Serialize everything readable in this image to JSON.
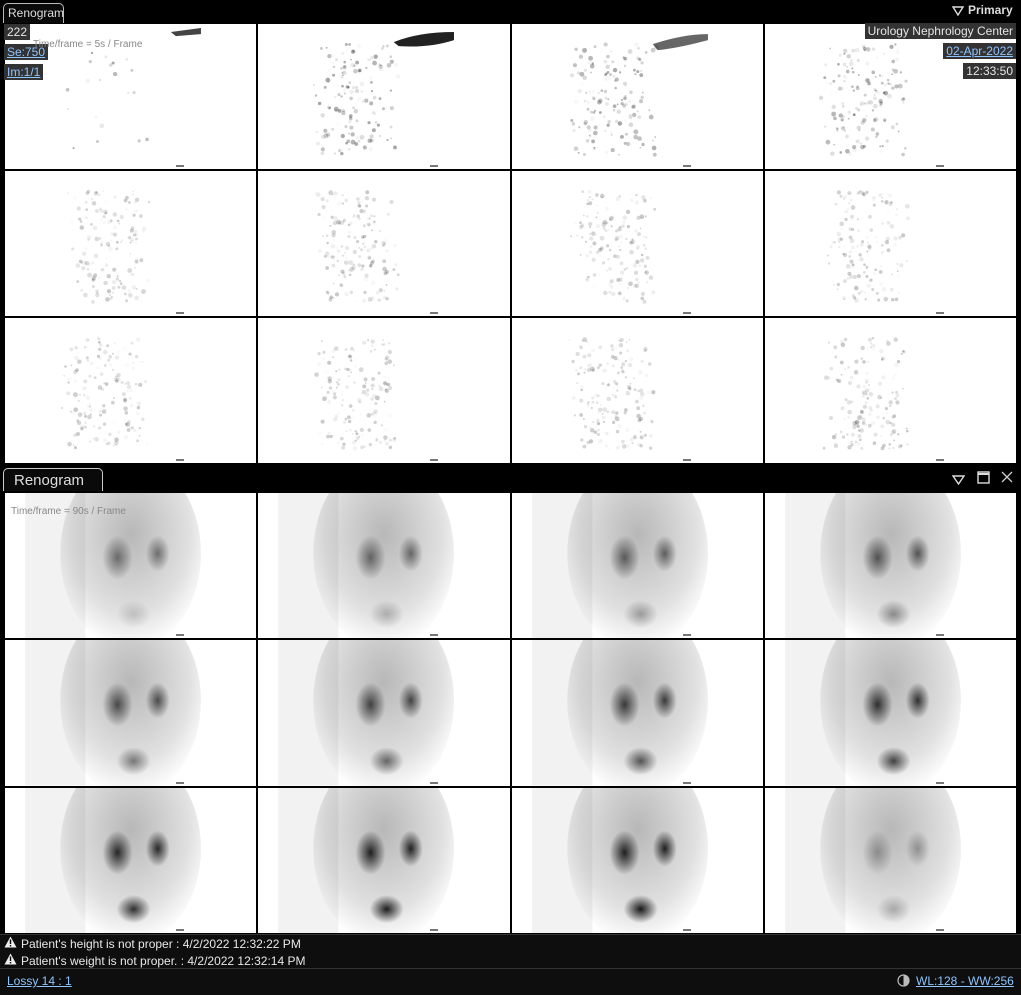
{
  "top_viewer": {
    "tab_title": "Renogram",
    "layout_label": "Primary",
    "frame_label": "Time/frame = 5s / Frame",
    "patient_id": "222",
    "series": "Se:750",
    "image": "Im:1/1",
    "institution": "Urology Nephrology Center",
    "date": "02-Apr-2022",
    "time": "12:33:50"
  },
  "bottom_viewer": {
    "tab_title": "Renogram",
    "frame_label": "Time/frame = 90s / Frame"
  },
  "warnings": [
    {
      "text": "Patient's height is not proper : 4/2/2022 12:32:22 PM",
      "icon": "warning-icon"
    },
    {
      "text": "Patient's weight is not proper. : 4/2/2022 12:32:14 PM",
      "icon": "warning-icon"
    }
  ],
  "footer": {
    "compression": "Lossy 14 : 1",
    "window_level": "WL:128 - WW:256",
    "contrast_icon": "contrast-icon"
  },
  "colors": {
    "background": "#000000",
    "frame_background": "#ffffff",
    "link": "#8ec5ff",
    "overlay_box": "#333333"
  }
}
